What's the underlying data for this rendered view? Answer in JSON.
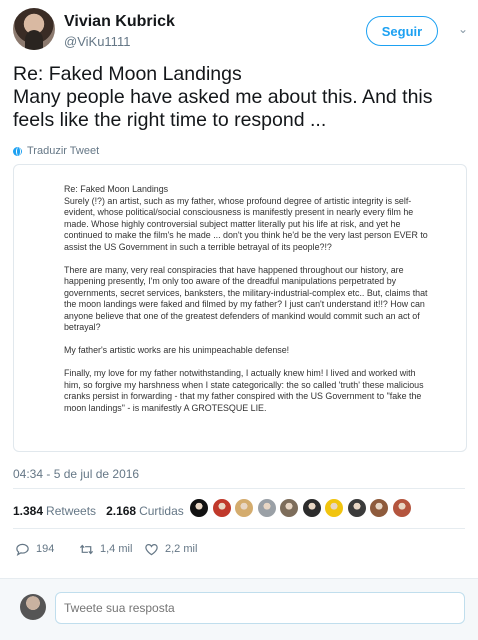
{
  "header": {
    "display_name": "Vivian Kubrick",
    "handle": "@ViKu1111",
    "follow_label": "Seguir"
  },
  "tweet": {
    "text_line1": "Re: Faked Moon Landings",
    "text_line2": "Many people have asked me about this. And this feels like the right time to respond ...",
    "translate_label": "Traduzir Tweet",
    "image_text": {
      "p0": "Re: Faked Moon Landings",
      "p1": "Surely (!?) an artist, such as my father, whose profound degree of artistic integrity is self-evident, whose political/social consciousness is manifestly present in nearly every film he made. Whose highly controversial subject matter literally put his life at risk, and yet he continued to make the film's he made ... don't you think he'd be the very last person EVER to assist the US Government in such a terrible betrayal of its people?!?",
      "p2": "There are many, very real conspiracies that have happened throughout our history, are happening presently, I'm only too aware of the dreadful manipulations perpetrated by governments, secret services, banksters, the military-industrial-complex etc.. But, claims that the moon landings were faked and filmed by my father? I just can't understand it!!? How can anyone believe that one of the greatest defenders of mankind would commit such an act of betrayal?",
      "p3": "My father's artistic works are his unimpeachable defense!",
      "p4": "Finally, my love for my father notwithstanding, I actually knew him! I lived and worked with him, so forgive my harshness when I state categorically: the so called 'truth' these malicious cranks persist in forwarding - that my father conspired with the US Government to \"fake the moon landings\" - is manifestly A GROTESQUE LIE."
    },
    "timestamp": "04:34 - 5 de jul de 2016"
  },
  "stats": {
    "retweets_count": "1.384",
    "retweets_label": "Retweets",
    "likes_count": "2.168",
    "likes_label": "Curtidas",
    "liker_avatars": [
      {
        "color": "#111111"
      },
      {
        "color": "#c0392b"
      },
      {
        "color": "#d4ac6e"
      },
      {
        "color": "#9aa0a6"
      },
      {
        "color": "#7d6d5b"
      },
      {
        "color": "#2c2c2c"
      },
      {
        "color": "#f1c40f"
      },
      {
        "color": "#3b3b3b"
      },
      {
        "color": "#8e5b3c"
      },
      {
        "color": "#b4553e"
      }
    ]
  },
  "actions": {
    "replies": "194",
    "retweets": "1,4 mil",
    "likes": "2,2 mil",
    "icons": [
      "reply-icon",
      "retweet-icon",
      "heart-icon"
    ]
  },
  "reply": {
    "placeholder": "Tweete sua resposta"
  },
  "colors": {
    "accent": "#1da1f2",
    "secondary_text": "#657786"
  }
}
